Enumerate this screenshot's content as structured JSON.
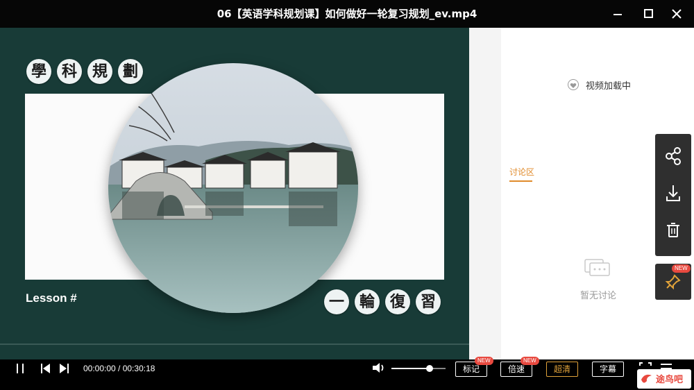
{
  "window": {
    "title": "06【英语学科规划课】如何做好一轮复习规划_ev.mp4",
    "controls": [
      "minimize-icon",
      "maximize-icon",
      "close-icon"
    ]
  },
  "video": {
    "title_chars": [
      "學",
      "科",
      "規",
      "劃"
    ],
    "subtitle_chars": [
      "一",
      "輪",
      "復",
      "習"
    ],
    "lesson_label": "Lesson #",
    "colors": {
      "background": "#183b37",
      "frame": "#fbfbfb"
    }
  },
  "panel": {
    "loading_text": "视频加载中",
    "discussion_tab": "讨论区",
    "empty_text": "暂无讨论",
    "accent": "#e08a2a"
  },
  "sidebar": {
    "buttons": [
      "share-icon",
      "download-icon",
      "trash-icon"
    ],
    "pin_badge": "NEW"
  },
  "player": {
    "current_time": "00:00:00",
    "duration": "00:30:18",
    "time_display": "00:00:00 / 00:30:18",
    "progress": 0,
    "volume": 0.7,
    "buttons": {
      "mark": "标记",
      "speed": "倍速",
      "quality": "超清",
      "subtitle": "字幕"
    },
    "badge_new": "NEW"
  },
  "watermark": {
    "text": "途鸟吧"
  }
}
